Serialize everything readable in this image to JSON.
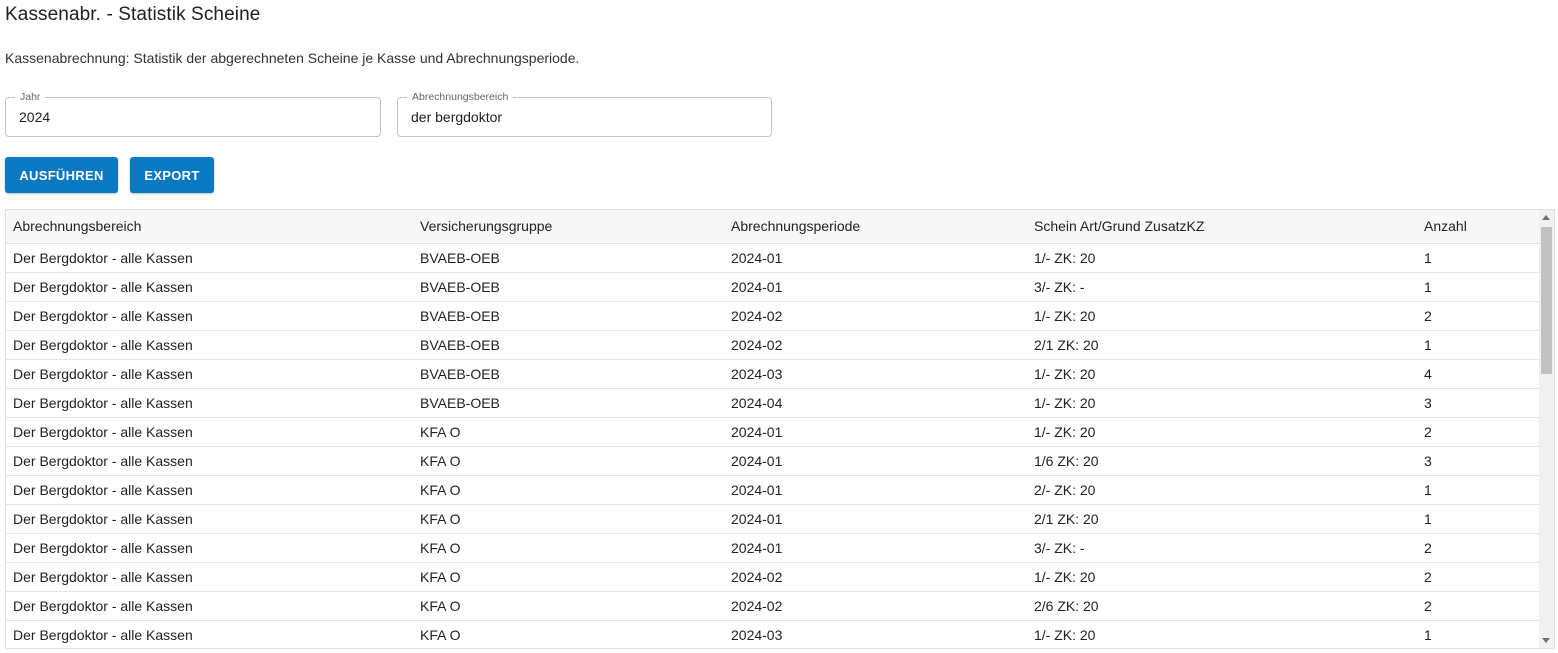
{
  "page": {
    "title": "Kassenabr. - Statistik Scheine",
    "description": "Kassenabrechnung: Statistik der abgerechneten Scheine je Kasse und Abrechnungsperiode."
  },
  "form": {
    "jahr": {
      "label": "Jahr",
      "value": "2024"
    },
    "abrechnungsbereich": {
      "label": "Abrechnungsbereich",
      "value": "der bergdoktor"
    }
  },
  "actions": {
    "run_label": "AUSFÜHREN",
    "export_label": "EXPORT"
  },
  "colors": {
    "button_bg": "#0a79c2",
    "header_bg": "#f7f7f7"
  },
  "table": {
    "columns": [
      "Abrechnungsbereich",
      "Versicherungsgruppe",
      "Abrechnungsperiode",
      "Schein Art/Grund ZusatzKZ",
      "Anzahl"
    ],
    "rows": [
      [
        "Der Bergdoktor - alle Kassen",
        "BVAEB-OEB",
        "2024-01",
        "1/- ZK: 20",
        "1"
      ],
      [
        "Der Bergdoktor - alle Kassen",
        "BVAEB-OEB",
        "2024-01",
        "3/- ZK: -",
        "1"
      ],
      [
        "Der Bergdoktor - alle Kassen",
        "BVAEB-OEB",
        "2024-02",
        "1/- ZK: 20",
        "2"
      ],
      [
        "Der Bergdoktor - alle Kassen",
        "BVAEB-OEB",
        "2024-02",
        "2/1 ZK: 20",
        "1"
      ],
      [
        "Der Bergdoktor - alle Kassen",
        "BVAEB-OEB",
        "2024-03",
        "1/- ZK: 20",
        "4"
      ],
      [
        "Der Bergdoktor - alle Kassen",
        "BVAEB-OEB",
        "2024-04",
        "1/- ZK: 20",
        "3"
      ],
      [
        "Der Bergdoktor - alle Kassen",
        "KFA O",
        "2024-01",
        "1/- ZK: 20",
        "2"
      ],
      [
        "Der Bergdoktor - alle Kassen",
        "KFA O",
        "2024-01",
        "1/6 ZK: 20",
        "3"
      ],
      [
        "Der Bergdoktor - alle Kassen",
        "KFA O",
        "2024-01",
        "2/- ZK: 20",
        "1"
      ],
      [
        "Der Bergdoktor - alle Kassen",
        "KFA O",
        "2024-01",
        "2/1 ZK: 20",
        "1"
      ],
      [
        "Der Bergdoktor - alle Kassen",
        "KFA O",
        "2024-01",
        "3/- ZK: -",
        "2"
      ],
      [
        "Der Bergdoktor - alle Kassen",
        "KFA O",
        "2024-02",
        "1/- ZK: 20",
        "2"
      ],
      [
        "Der Bergdoktor - alle Kassen",
        "KFA O",
        "2024-02",
        "2/6 ZK: 20",
        "2"
      ],
      [
        "Der Bergdoktor - alle Kassen",
        "KFA O",
        "2024-03",
        "1/- ZK: 20",
        "1"
      ]
    ]
  }
}
